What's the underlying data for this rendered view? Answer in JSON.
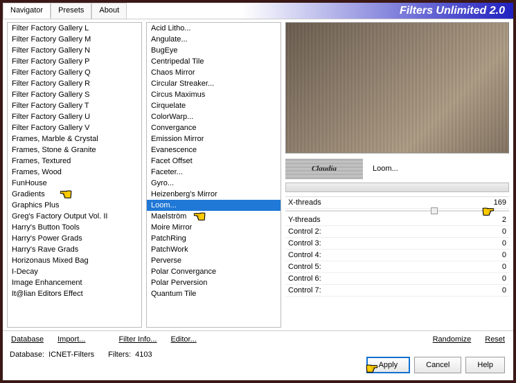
{
  "title": "Filters Unlimited 2.0",
  "tabs": [
    "Navigator",
    "Presets",
    "About"
  ],
  "active_tab": 0,
  "categories": [
    "Filter Factory Gallery L",
    "Filter Factory Gallery M",
    "Filter Factory Gallery N",
    "Filter Factory Gallery P",
    "Filter Factory Gallery Q",
    "Filter Factory Gallery R",
    "Filter Factory Gallery S",
    "Filter Factory Gallery T",
    "Filter Factory Gallery U",
    "Filter Factory Gallery V",
    "Frames, Marble & Crystal",
    "Frames, Stone & Granite",
    "Frames, Textured",
    "Frames, Wood",
    "FunHouse",
    "Gradients",
    "Graphics Plus",
    "Greg's Factory Output Vol. II",
    "Harry's Button Tools",
    "Harry's Power Grads",
    "Harry's Rave Grads",
    "Horizonaus Mixed Bag",
    "I-Decay",
    "Image Enhancement",
    "It@lian Editors Effect"
  ],
  "filters": [
    "Acid Litho...",
    "Angulate...",
    "BugEye",
    "Centripedal Tile",
    "Chaos Mirror",
    "Circular Streaker...",
    "Circus Maximus",
    "Cirquelate",
    "ColorWarp...",
    "Convergance",
    "Emission Mirror",
    "Evanescence",
    "Facet Offset",
    "Faceter...",
    "Gyro...",
    "Heizenberg's Mirror",
    "Loom...",
    "Maelström",
    "Moire Mirror",
    "PatchRing",
    "PatchWork",
    "Perverse",
    "Polar Convergance",
    "Polar Perversion",
    "Quantum Tile"
  ],
  "selected_filter_index": 16,
  "badge_text": "Claudia",
  "current_filter": "Loom...",
  "params": [
    {
      "name": "X-threads",
      "value": 169
    },
    {
      "name": "Y-threads",
      "value": 2
    },
    {
      "name": "Control 2:",
      "value": 0
    },
    {
      "name": "Control 3:",
      "value": 0
    },
    {
      "name": "Control 4:",
      "value": 0
    },
    {
      "name": "Control 5:",
      "value": 0
    },
    {
      "name": "Control 6:",
      "value": 0
    },
    {
      "name": "Control 7:",
      "value": 0
    }
  ],
  "toolbar": {
    "database": "Database",
    "import": "Import...",
    "filter_info": "Filter Info...",
    "editor": "Editor...",
    "randomize": "Randomize",
    "reset": "Reset"
  },
  "status": {
    "db_label": "Database:",
    "db_value": "ICNET-Filters",
    "filters_label": "Filters:",
    "filters_value": "4103"
  },
  "footer": {
    "apply": "Apply",
    "cancel": "Cancel",
    "help": "Help"
  }
}
